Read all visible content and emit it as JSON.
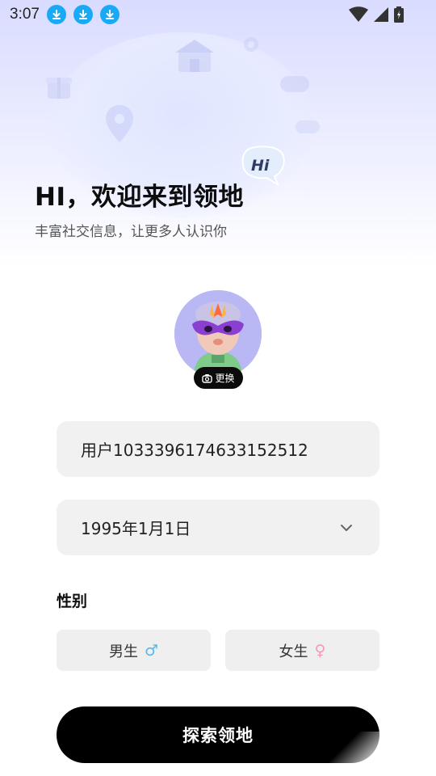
{
  "status_bar": {
    "time": "3:07",
    "download_icons": [
      "download-icon",
      "download-icon",
      "download-icon"
    ],
    "right_icons": [
      "wifi-icon",
      "signal-icon",
      "battery-icon"
    ]
  },
  "hero": {
    "title": "HI，欢迎来到领地",
    "subtitle": "丰富社交信息，让更多人认识你",
    "badge_text": "Hi"
  },
  "avatar": {
    "change_label": "更换"
  },
  "form": {
    "username": "用户1033396174633152512",
    "birthday": "1995年1月1日",
    "gender_label": "性别",
    "male_label": "男生",
    "male_symbol": "♂",
    "female_label": "女生",
    "female_symbol": "♀",
    "submit_label": "探索领地"
  },
  "colors": {
    "accent": "#000000",
    "download_badge": "#1aa9f5",
    "male": "#5bb6e8",
    "female": "#f29abd"
  }
}
